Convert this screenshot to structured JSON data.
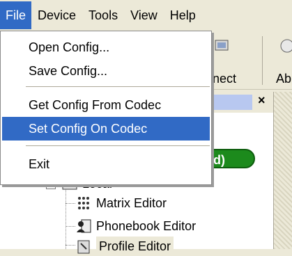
{
  "menubar": {
    "items": [
      {
        "label": "File"
      },
      {
        "label": "Device"
      },
      {
        "label": "Tools"
      },
      {
        "label": "View"
      },
      {
        "label": "Help"
      }
    ]
  },
  "toolbar": {
    "connect_label": "nect",
    "about_label": "Ab"
  },
  "file_menu": {
    "items": [
      {
        "label": "Open Config..."
      },
      {
        "label": "Save Config..."
      },
      {
        "label": "Get Config From Codec"
      },
      {
        "label": "Set Config On Codec"
      },
      {
        "label": "Exit"
      }
    ]
  },
  "pane": {
    "close_glyph": "×",
    "status_badge": "cted)"
  },
  "tree": {
    "root_label": "Local",
    "children": [
      {
        "label": "Matrix Editor",
        "icon": "matrix-icon"
      },
      {
        "label": "Phonebook Editor",
        "icon": "phonebook-icon"
      },
      {
        "label": "Profile Editor",
        "icon": "profile-icon"
      }
    ]
  },
  "colors": {
    "highlight": "#316ac5",
    "badge": "#1c8a1c"
  }
}
